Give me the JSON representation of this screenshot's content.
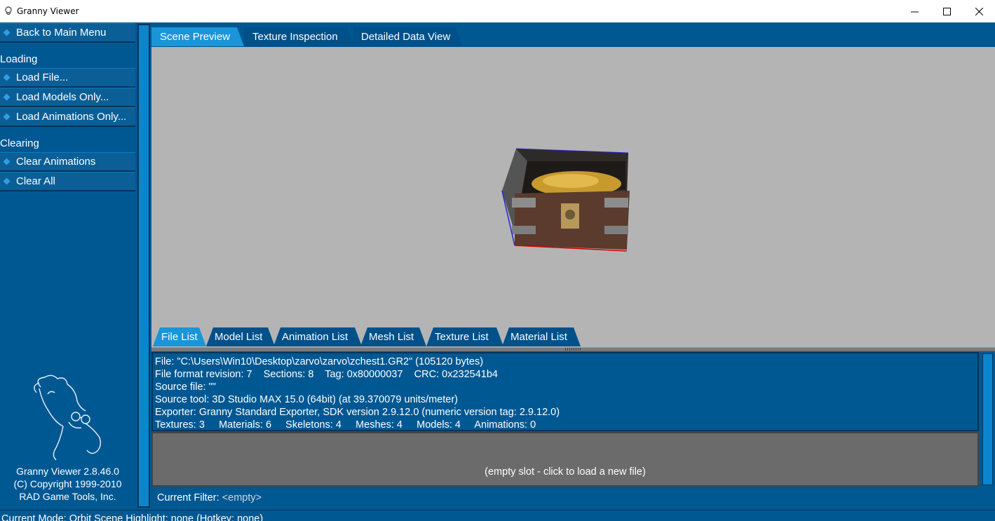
{
  "window": {
    "title": "Granny Viewer",
    "controls": {
      "minimize_icon": "minimize-icon",
      "maximize_icon": "maximize-icon",
      "close_icon": "close-icon"
    }
  },
  "sidebar": {
    "back": "Back to Main Menu",
    "loading_header": "Loading",
    "loading_items": [
      "Load File...",
      "Load Models Only...",
      "Load Animations Only..."
    ],
    "clearing_header": "Clearing",
    "clearing_items": [
      "Clear Animations",
      "Clear All"
    ],
    "about": [
      "Granny Viewer 2.8.46.0",
      "(C) Copyright 1999-2010",
      "RAD Game Tools, Inc."
    ]
  },
  "tabs": {
    "top": [
      "Scene Preview",
      "Texture Inspection",
      "Detailed Data View"
    ],
    "top_active": 0,
    "bottom": [
      "File List",
      "Model List",
      "Animation List",
      "Mesh List",
      "Texture List",
      "Material List"
    ],
    "bottom_active": 0
  },
  "file_info": {
    "lines": [
      "File: \"C:\\Users\\Win10\\Desktop\\zarvo\\zarvo\\zchest1.GR2\" (105120 bytes)",
      "File format revision: 7    Sections: 8    Tag: 0x80000037    CRC: 0x232541b4",
      "Source file: \"\"",
      "Source tool: 3D Studio MAX 15.0 (64bit) (at 39.370079 units/meter)",
      "Exporter: Granny Standard Exporter, SDK version 2.9.12.0 (numeric version tag: 2.9.12.0)",
      "Textures: 3     Materials: 6     Skeletons: 4     Meshes: 4     Models: 4     Animations: 0"
    ]
  },
  "empty_slot": "(empty slot - click to load a new file)",
  "filter": {
    "label": "Current Filter:",
    "value": "<empty>"
  },
  "status": "Current Mode: Orbit Scene   Highlight: none (Hotkey: none)",
  "colors": {
    "panel": "#005893",
    "tab_active": "#1a95d8",
    "viewport": "#b4b4b4"
  }
}
